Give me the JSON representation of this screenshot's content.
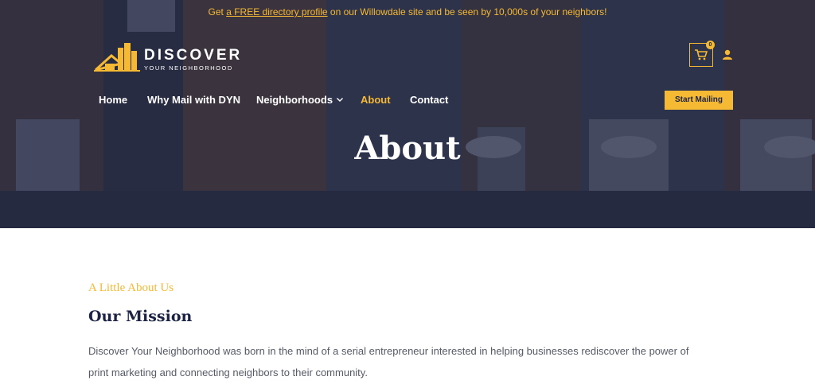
{
  "announcement": {
    "prefix": "Get ",
    "link": "a FREE directory profile",
    "suffix": " on our Willowdale site and be seen by 10,000s of your neighbors!"
  },
  "logo": {
    "line1": "DISCOVER",
    "line2": "YOUR NEIGHBORHOOD"
  },
  "header": {
    "cart_count": "0"
  },
  "nav": {
    "items": [
      {
        "label": "Home"
      },
      {
        "label": "Why Mail with DYN"
      },
      {
        "label": "Neighborhoods"
      },
      {
        "label": "About"
      },
      {
        "label": "Contact"
      }
    ],
    "cta": "Start Mailing"
  },
  "hero": {
    "title": "About"
  },
  "content": {
    "eyebrow": "A Little About Us",
    "title": "Our Mission",
    "body": "Discover Your Neighborhood was born in the mind of a serial entrepreneur interested in helping businesses rediscover the power of print marketing and connecting neighbors to their community."
  },
  "colors": {
    "accent": "#f5b933",
    "navy": "#1c2244",
    "text": "#555a66"
  }
}
